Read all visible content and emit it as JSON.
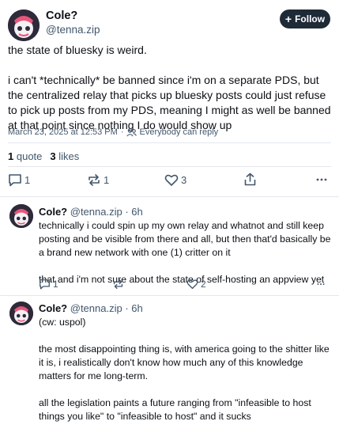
{
  "main_post": {
    "author_name": "Cole?",
    "author_handle": "@tenna.zip",
    "follow_label": "Follow",
    "paragraphs": [
      "the state of bluesky is weird.",
      "i can't *technically* be banned since i'm on a separate PDS, but the centralized relay that picks up bluesky posts could just refuse to pick up posts from my PDS, meaning I might as well be banned at that point since nothing I do would show up"
    ],
    "timestamp": "March 23, 2025 at 12:53 PM",
    "meta_separator": "·",
    "audience": "Everybody can reply",
    "quote_count": "1",
    "quote_label": "quote",
    "like_count": "3",
    "like_label": "likes",
    "reply_count": "1",
    "repost_count": "1",
    "like_count_action": "3"
  },
  "replies": [
    {
      "author_name": "Cole?",
      "author_handle": "@tenna.zip · 6h",
      "paragraphs": [
        "technically i could spin up my own relay and whatnot and still keep posting and be visible from there and all, but then that'd basically be a brand new network with one (1) critter on it",
        "that and i'm not sure about the state of self-hosting an appview yet"
      ],
      "reply_count": "1",
      "like_count": "2"
    },
    {
      "author_name": "Cole?",
      "author_handle": "@tenna.zip · 6h",
      "paragraphs": [
        "(cw: uspol)",
        "the most disappointing thing is, with america going to the shitter like it is, i realistically don't know how much any of this knowledge matters for me long-term.",
        "all the legislation paints a future ranging from \"infeasible to host things you like\" to \"infeasible to host\" and it sucks"
      ]
    }
  ],
  "colors": {
    "text": "#0b0f14",
    "muted": "#42576c",
    "divider": "#e3e8ee",
    "follow_bg": "#1f2a37",
    "avatar_bg": "#2e2a3a",
    "avatar_accent": "#e8567a"
  },
  "icons": [
    "plus-icon",
    "people-icon",
    "reply-icon",
    "repost-icon",
    "heart-icon",
    "share-icon",
    "more-icon"
  ]
}
